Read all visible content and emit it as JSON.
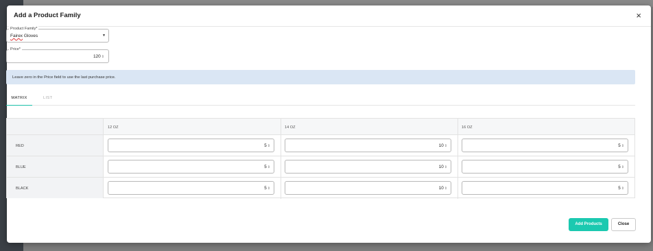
{
  "modal": {
    "title": "Add a Product Family",
    "close_glyph": "×"
  },
  "product_family": {
    "label": "Product Family*",
    "value_brand": "Fairex",
    "value_rest": " Gloves"
  },
  "price": {
    "label": "Price*",
    "value": "120"
  },
  "info_text": "Leave zero in the Price field to use the last purchase price.",
  "tabs": [
    {
      "label": "MATRIX",
      "active": true
    },
    {
      "label": "LIST",
      "active": false
    }
  ],
  "matrix": {
    "columns": [
      "12 OZ",
      "14 OZ",
      "16 OZ"
    ],
    "rows": [
      {
        "label": "RED",
        "values": [
          "5",
          "10",
          "5"
        ]
      },
      {
        "label": "BLUE",
        "values": [
          "5",
          "10",
          "5"
        ]
      },
      {
        "label": "BLACK",
        "values": [
          "5",
          "10",
          "5"
        ]
      }
    ]
  },
  "actions": {
    "add_label": "Add Products",
    "close_label": "Close"
  },
  "colors": {
    "accent": "#1bc9b0",
    "info_bg": "#dae6f4"
  }
}
